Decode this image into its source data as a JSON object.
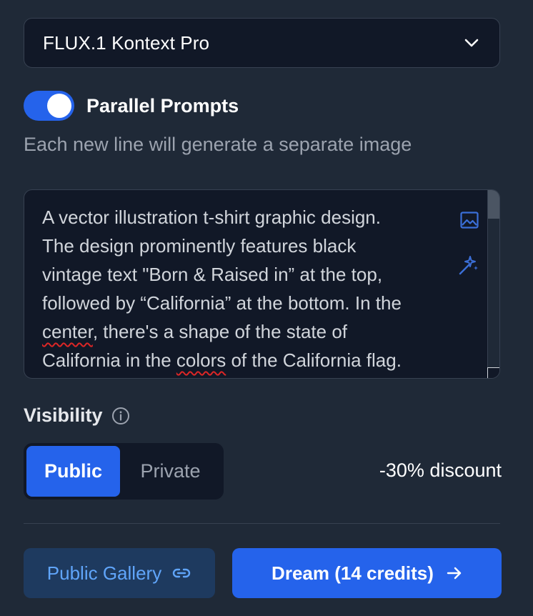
{
  "model_select": {
    "selected": "FLUX.1 Kontext Pro",
    "icon": "chevron-down-icon"
  },
  "parallel_prompts": {
    "label": "Parallel Prompts",
    "enabled": true,
    "hint": "Each new line will generate a separate image"
  },
  "prompt": {
    "lines": [
      "A vector illustration t-shirt graphic design.",
      "The design prominently features black",
      "vintage text \"Born & Raised in” at the top,",
      "followed by “California” at the bottom. In the",
      "center",
      ", there's a shape of the state of",
      "California in the ",
      "colors",
      " of the California flag."
    ],
    "icons": [
      "image-icon",
      "magic-wand-icon"
    ]
  },
  "visibility": {
    "label": "Visibility",
    "icon": "info-icon",
    "options": [
      "Public",
      "Private"
    ],
    "selected": "Public",
    "discount": "-30% discount"
  },
  "actions": {
    "gallery_label": "Public Gallery",
    "gallery_icon": "link-icon",
    "dream_label": "Dream (14 credits)",
    "dream_icon": "arrow-right-icon"
  },
  "colors": {
    "background": "#1f2937",
    "panel": "#111827",
    "accent": "#2563eb",
    "link": "#60a5fa"
  }
}
